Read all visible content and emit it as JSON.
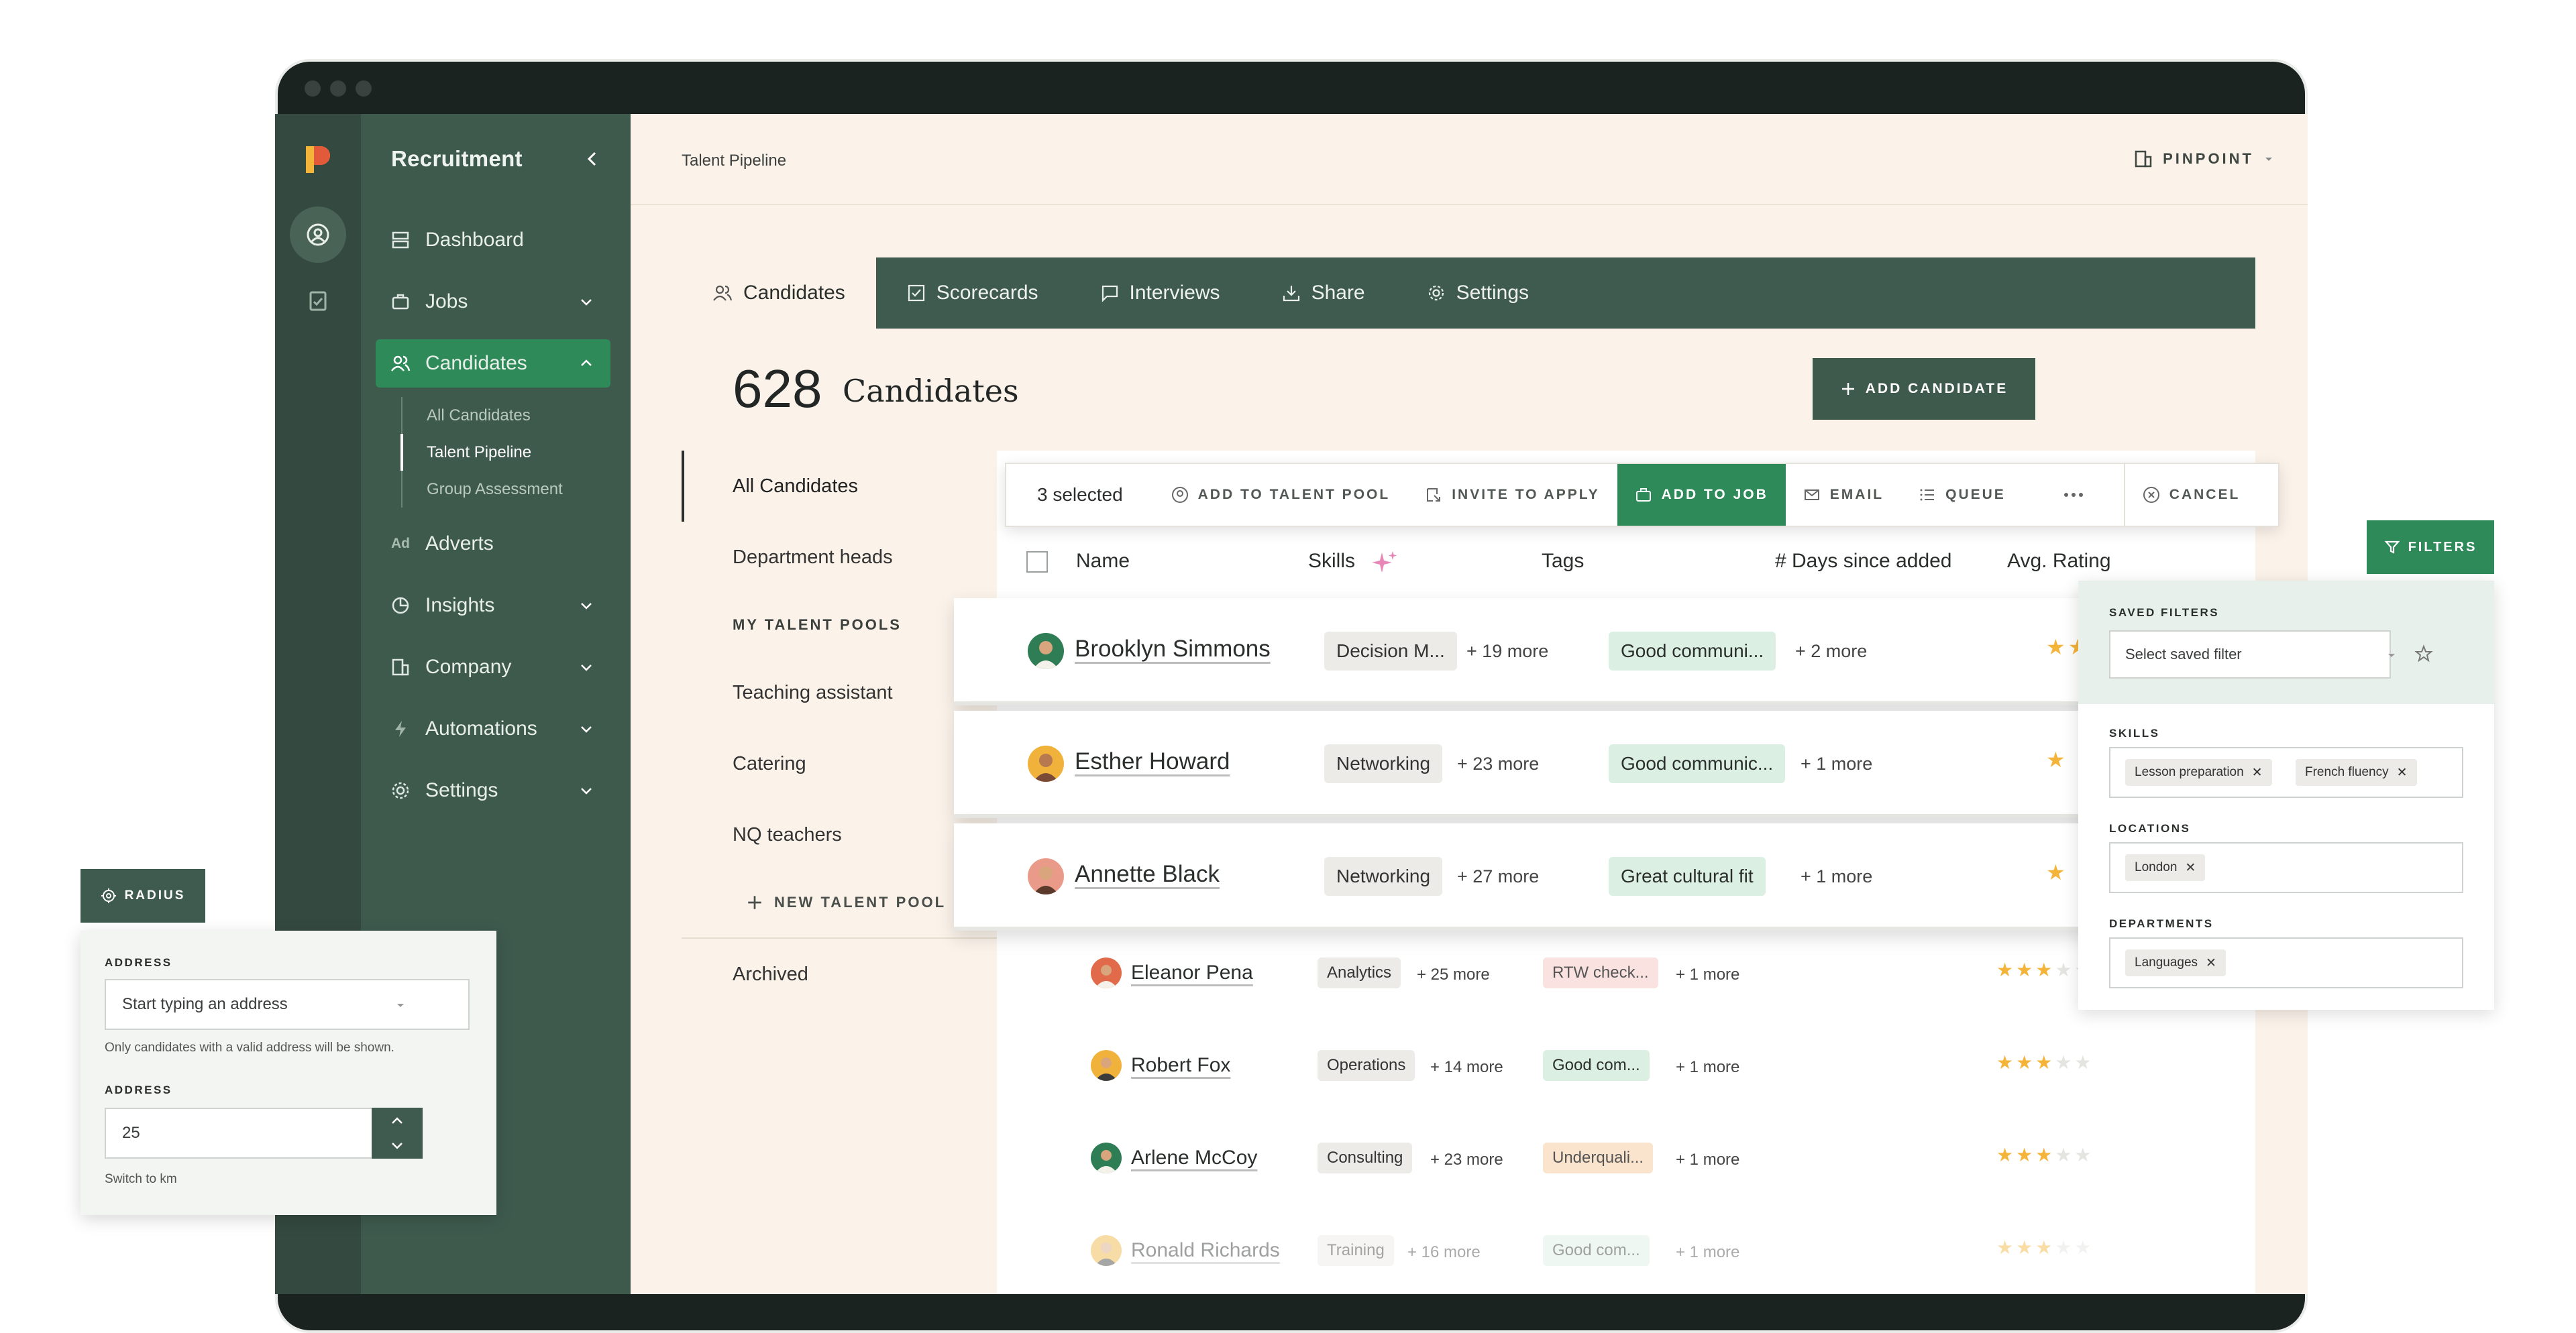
{
  "sidebar": {
    "title": "Recruitment",
    "items": [
      {
        "label": "Dashboard",
        "icon": "dashboard-icon"
      },
      {
        "label": "Jobs",
        "icon": "briefcase-icon"
      },
      {
        "label": "Candidates",
        "icon": "users-icon",
        "active": true
      },
      {
        "label": "Adverts",
        "icon": "adverts-icon"
      },
      {
        "label": "Insights",
        "icon": "pie-chart-icon"
      },
      {
        "label": "Company",
        "icon": "building-icon"
      },
      {
        "label": "Automations",
        "icon": "lightning-icon"
      },
      {
        "label": "Settings",
        "icon": "gear-icon"
      }
    ],
    "sub": [
      "All Candidates",
      "Talent Pipeline",
      "Group Assessment"
    ],
    "adverts_prefix": "Ad"
  },
  "header": {
    "breadcrumb": "Talent Pipeline",
    "brand": "PINPOINT"
  },
  "tabs": [
    "Candidates",
    "Scorecards",
    "Interviews",
    "Share",
    "Settings"
  ],
  "summary": {
    "count": "628",
    "label": "Candidates",
    "add_button": "ADD CANDIDATE"
  },
  "left_list": {
    "all": "All Candidates",
    "dept": "Department heads",
    "pools_heading": "MY TALENT POOLS",
    "pools": [
      "Teaching assistant",
      "Catering",
      "NQ teachers"
    ],
    "new_pool": "NEW TALENT POOL",
    "archived": "Archived"
  },
  "table": {
    "columns": [
      "Name",
      "Skills",
      "Tags",
      "# Days since added",
      "Avg. Rating"
    ]
  },
  "selection_bar": {
    "count": "3 selected",
    "actions": [
      "ADD TO TALENT POOL",
      "INVITE TO APPLY",
      "ADD TO JOB",
      "EMAIL",
      "QUEUE",
      "CANCEL"
    ]
  },
  "selected_rows": [
    {
      "name": "Brooklyn Simmons",
      "skill": "Decision M...",
      "skill_more": "+ 19 more",
      "tag": "Good communi...",
      "tag_more": "+ 2 more"
    },
    {
      "name": "Esther Howard",
      "skill": "Networking",
      "skill_more": "+ 23 more",
      "tag": "Good communic...",
      "tag_more": "+ 1 more"
    },
    {
      "name": "Annette Black",
      "skill": "Networking",
      "skill_more": "+ 27 more",
      "tag": "Great cultural fit",
      "tag_more": "+ 1 more"
    }
  ],
  "rows": [
    {
      "name": "Eleanor Pena",
      "skill": "Analytics",
      "skill_more": "+ 25 more",
      "tag": "RTW check...",
      "tag_more": "+ 1 more",
      "tag_color": "#f9e2df",
      "rating": 3
    },
    {
      "name": "Robert Fox",
      "skill": "Operations",
      "skill_more": "+ 14 more",
      "tag": "Good com...",
      "tag_more": "+ 1 more",
      "tag_color": "#dcefe3",
      "rating": 3
    },
    {
      "name": "Arlene McCoy",
      "skill": "Consulting",
      "skill_more": "+ 23 more",
      "tag": "Underquali...",
      "tag_more": "+ 1 more",
      "tag_color": "#fbe4cd",
      "rating": 3
    },
    {
      "name": "Ronald Richards",
      "skill": "Training",
      "skill_more": "+ 16 more",
      "tag": "Good com...",
      "tag_more": "+ 1 more",
      "tag_color": "#dcefe3",
      "rating": 3
    }
  ],
  "filters": {
    "button": "FILTERS",
    "saved_label": "SAVED FILTERS",
    "saved_placeholder": "Select saved filter",
    "skills_label": "SKILLS",
    "skills": [
      "Lesson preparation",
      "French fluency"
    ],
    "locations_label": "LOCATIONS",
    "locations": [
      "London"
    ],
    "departments_label": "DEPARTMENTS",
    "departments": [
      "Languages"
    ]
  },
  "radius": {
    "button": "RADIUS",
    "address_label": "ADDRESS",
    "address_placeholder": "Start typing an address",
    "address_hint": "Only candidates with a valid address will be shown.",
    "radius_label": "ADDRESS",
    "radius_value": "25",
    "switch": "Switch to km"
  },
  "colors": {
    "sidebar": "#3e5a4d",
    "accent": "#2f8a5a",
    "star": "#f4b43a",
    "star_empty": "#e4e4e0"
  }
}
